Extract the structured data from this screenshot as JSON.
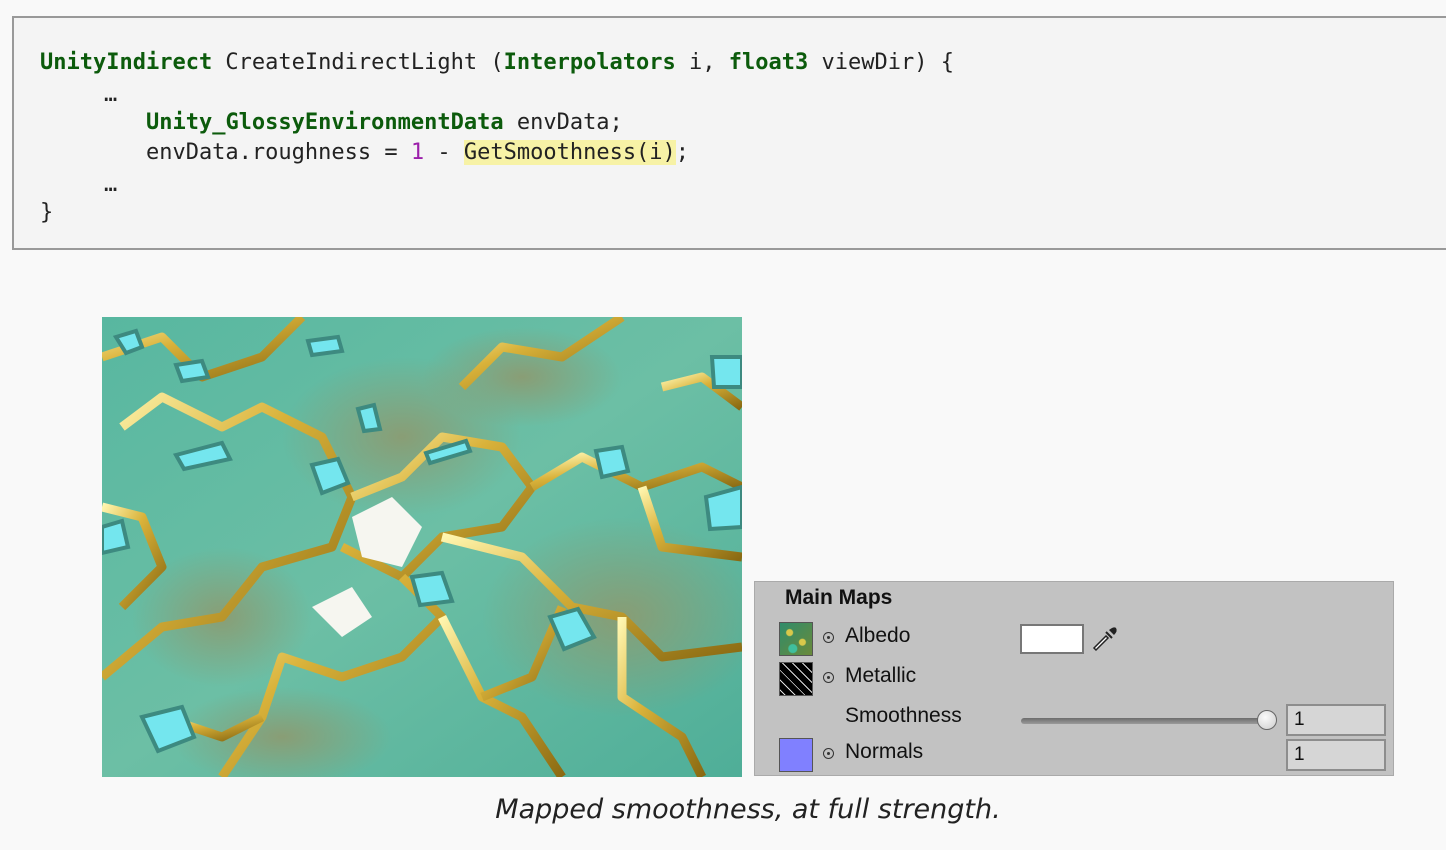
{
  "code": {
    "line1": {
      "type1": "UnityIndirect",
      "fn": " CreateIndirectLight (",
      "type2": "Interpolators",
      "mid": " i, ",
      "type3": "float3",
      "end": " viewDir) {"
    },
    "ellipsis": "…",
    "line3": {
      "indent": "        ",
      "type": "Unity_GlossyEnvironmentData",
      "rest": " envData;"
    },
    "line4": {
      "pre": "        envData.roughness = ",
      "number": "1",
      "minus": " - ",
      "call": "GetSmoothness(i)",
      "semi": ";"
    },
    "close": "}"
  },
  "figure": {
    "name": "metal-circuit-render"
  },
  "panel": {
    "title": "Main Maps",
    "albedo": "Albedo",
    "metallic": "Metallic",
    "smoothness": "Smoothness",
    "smoothness_value": "1",
    "normals": "Normals",
    "normals_value": "1",
    "smoothness_level": 1.0,
    "colors": {
      "normals_thumb": "#8080ff",
      "albedo_tint": "#ffffff"
    }
  },
  "caption": "Mapped smoothness, at full strength."
}
